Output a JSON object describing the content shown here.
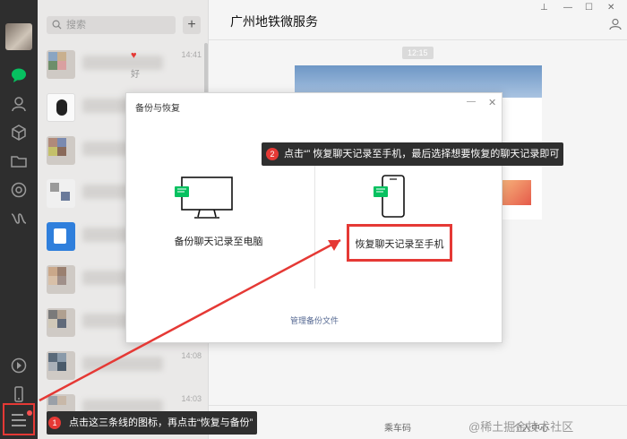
{
  "search": {
    "placeholder": "搜索"
  },
  "list": {
    "add_label": "+",
    "items": [
      {
        "title": "",
        "time": "14:41",
        "sub": "好"
      },
      {
        "title": "",
        "time": "",
        "sub": ""
      },
      {
        "title": "",
        "time": "",
        "sub": ""
      },
      {
        "title": "",
        "time": "",
        "sub": ""
      },
      {
        "title": "",
        "time": "",
        "sub": ""
      },
      {
        "title": "",
        "time": "",
        "sub": ""
      },
      {
        "title": "",
        "time": "",
        "sub": ""
      },
      {
        "title": "",
        "time": "",
        "sub": ""
      },
      {
        "title": "",
        "time": "14:08",
        "sub": ""
      },
      {
        "title": "",
        "time": "14:03",
        "sub": ""
      }
    ]
  },
  "chat": {
    "title": "广州地铁微服务",
    "time": "12:15",
    "tabs": [
      "乘车码",
      "个人中心"
    ]
  },
  "dialog": {
    "title": "备份与恢复",
    "backup_label": "备份聊天记录至电脑",
    "restore_label": "恢复聊天记录至手机",
    "manage_link": "管理备份文件"
  },
  "annotations": {
    "step1_num": "1",
    "step1_text": "点击这三条线的图标，再点击“恢复与备份”",
    "step2_num": "2",
    "step2_text": "点击“” 恢复聊天记录至手机，最后选择想要恢复的聊天记录即可",
    "color": "#e53935"
  },
  "watermark": "@稀土掘金技术社区"
}
